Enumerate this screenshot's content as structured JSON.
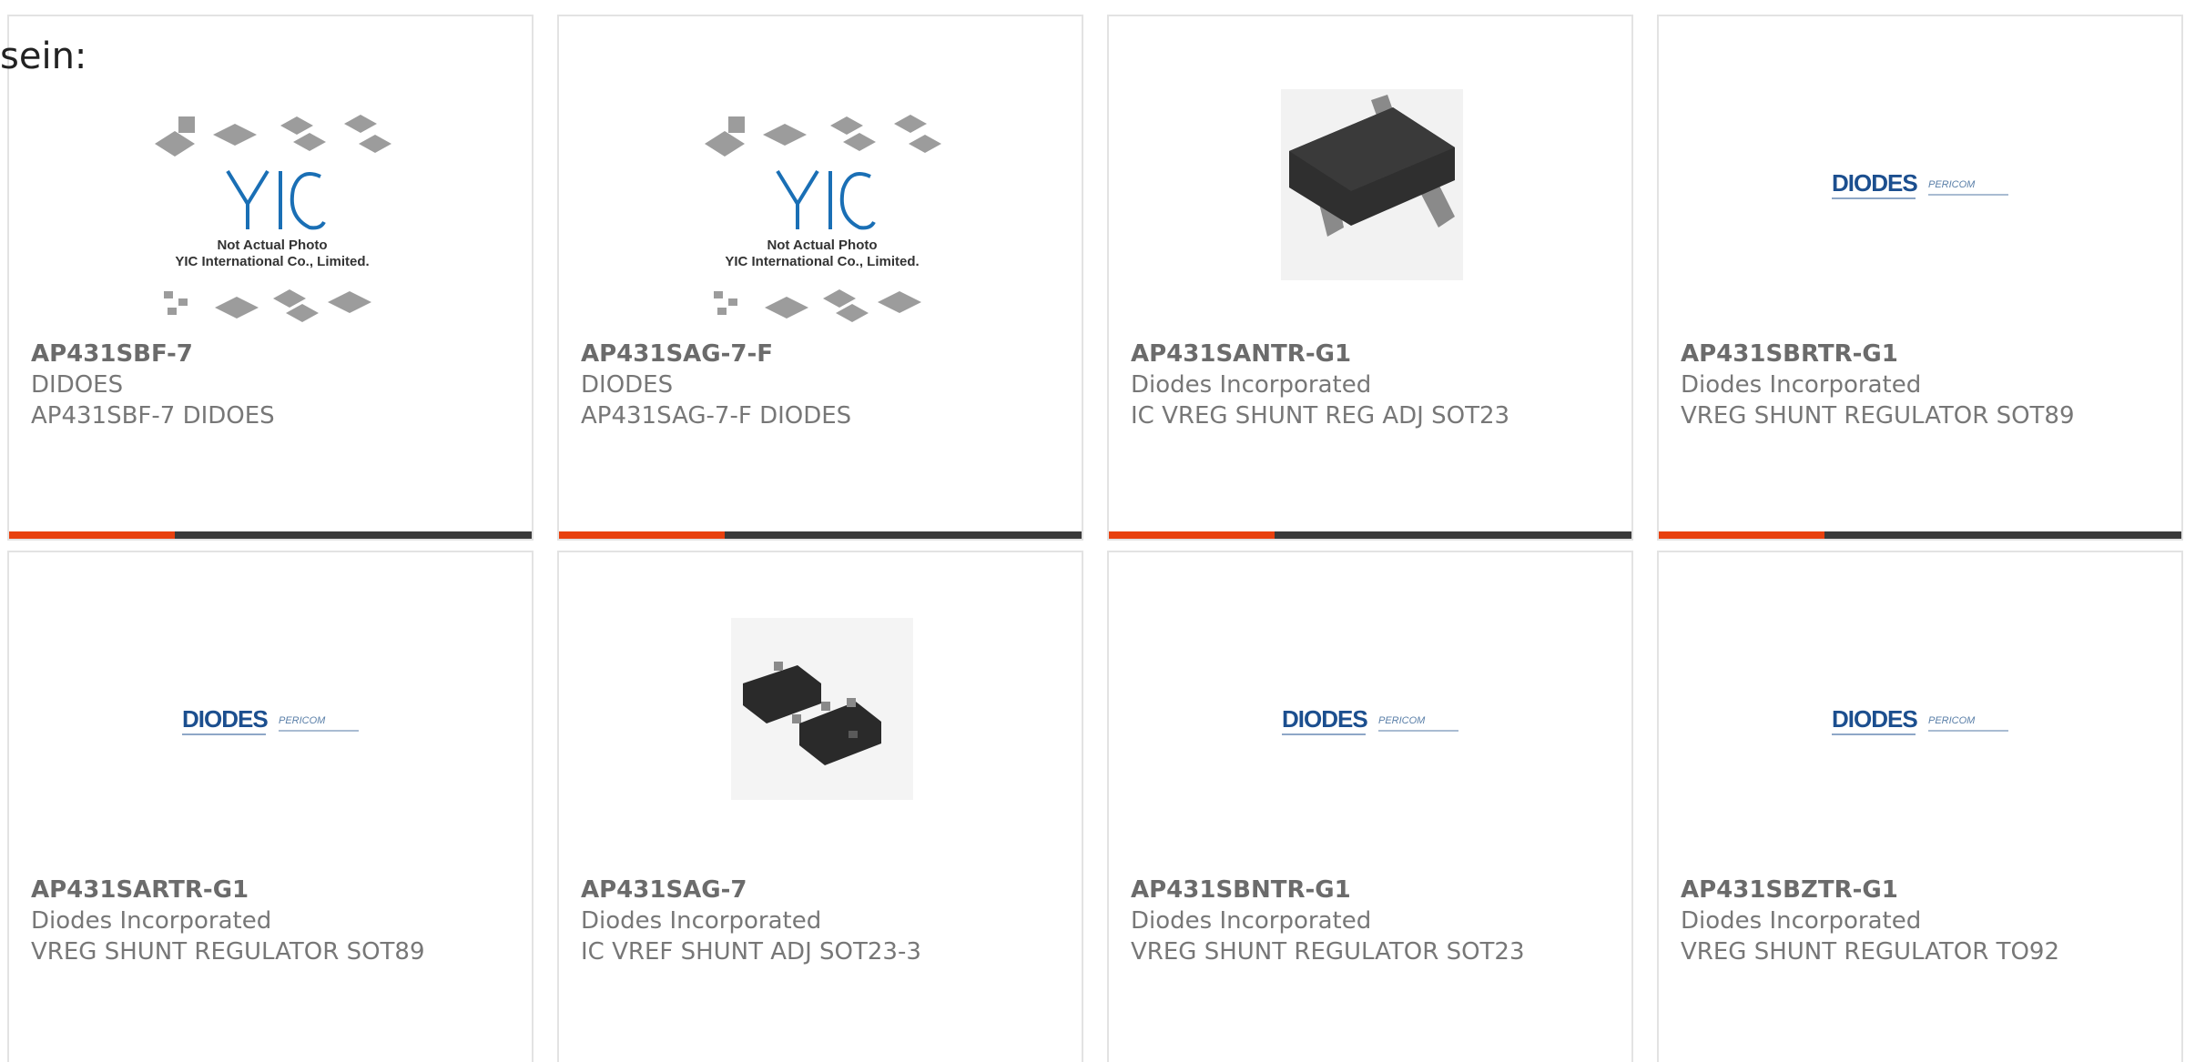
{
  "intro_text": "sein:",
  "products": [
    {
      "part_number": "AP431SBF-7",
      "manufacturer": "DIDOES",
      "description": "AP431SBF-7 DIDOES",
      "image": "yic-placeholder",
      "placeholder_title": "Not Actual Photo",
      "placeholder_company": "YIC International Co., Limited."
    },
    {
      "part_number": "AP431SAG-7-F",
      "manufacturer": "DIODES",
      "description": "AP431SAG-7-F DIODES",
      "image": "yic-placeholder",
      "placeholder_title": "Not Actual Photo",
      "placeholder_company": "YIC International Co., Limited."
    },
    {
      "part_number": "AP431SANTR-G1",
      "manufacturer": "Diodes Incorporated",
      "description": "IC VREG SHUNT REG ADJ SOT23",
      "image": "sot23-chip"
    },
    {
      "part_number": "AP431SBRTR-G1",
      "manufacturer": "Diodes Incorporated",
      "description": "VREG SHUNT REGULATOR SOT89",
      "image": "diodes-pericom-logo"
    },
    {
      "part_number": "AP431SARTR-G1",
      "manufacturer": "Diodes Incorporated",
      "description": "VREG SHUNT REGULATOR SOT89",
      "image": "diodes-pericom-logo"
    },
    {
      "part_number": "AP431SAG-7",
      "manufacturer": "Diodes Incorporated",
      "description": "IC VREF SHUNT ADJ SOT23-3",
      "image": "sot23-pair"
    },
    {
      "part_number": "AP431SBNTR-G1",
      "manufacturer": "Diodes Incorporated",
      "description": "VREG SHUNT REGULATOR SOT23",
      "image": "diodes-pericom-logo"
    },
    {
      "part_number": "AP431SBZTR-G1",
      "manufacturer": "Diodes Incorporated",
      "description": "VREG SHUNT REGULATOR TO92",
      "image": "diodes-pericom-logo"
    }
  ],
  "logo_text": {
    "diodes": "DIODES",
    "pericom": "PERICOM"
  },
  "colors": {
    "accent": "#e8410f",
    "bar": "#3a3a3a",
    "diodes_blue": "#1c4f8f"
  }
}
